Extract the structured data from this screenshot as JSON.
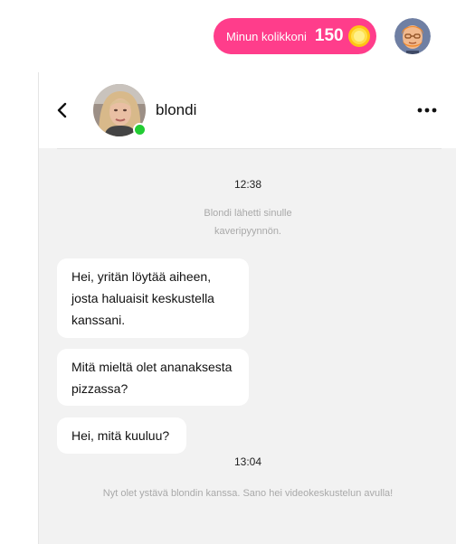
{
  "topbar": {
    "coins_label": "Minun kolikkoni",
    "coins_count": "150",
    "coin_color": "#ffd21f",
    "pill_color": "#ff3d8b"
  },
  "chat": {
    "contact_name": "blondi",
    "online_status_color": "#22cc33",
    "timestamp_first": "12:38",
    "system_friend_request": "Blondi lähetti sinulle kaveripyynnön.",
    "messages": [
      {
        "text": "Hei, yritän löytää aiheen, josta haluaisit keskustella kanssani."
      },
      {
        "text": "Mitä mieltä olet ananaksesta pizzassa?"
      },
      {
        "text": "Hei, mitä kuuluu?"
      }
    ],
    "timestamp_second": "13:04",
    "system_now_friends": "Nyt olet ystävä blondin kanssa. Sano hei videokeskustelun avulla!"
  }
}
